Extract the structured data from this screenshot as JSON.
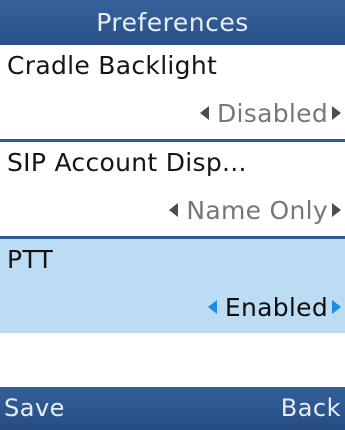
{
  "header": {
    "title": "Preferences"
  },
  "items": [
    {
      "label": "Cradle Backlight",
      "value": "Disabled",
      "selected": false
    },
    {
      "label": "SIP Account Disp...",
      "value": "Name Only",
      "selected": false
    },
    {
      "label": "PTT",
      "value": "Enabled",
      "selected": true
    }
  ],
  "softkeys": {
    "left": "Save",
    "right": "Back"
  },
  "colors": {
    "header_bg": "#2f5b93",
    "selected_bg": "#bcdcf3",
    "selected_arrow": "#1c8be4"
  }
}
